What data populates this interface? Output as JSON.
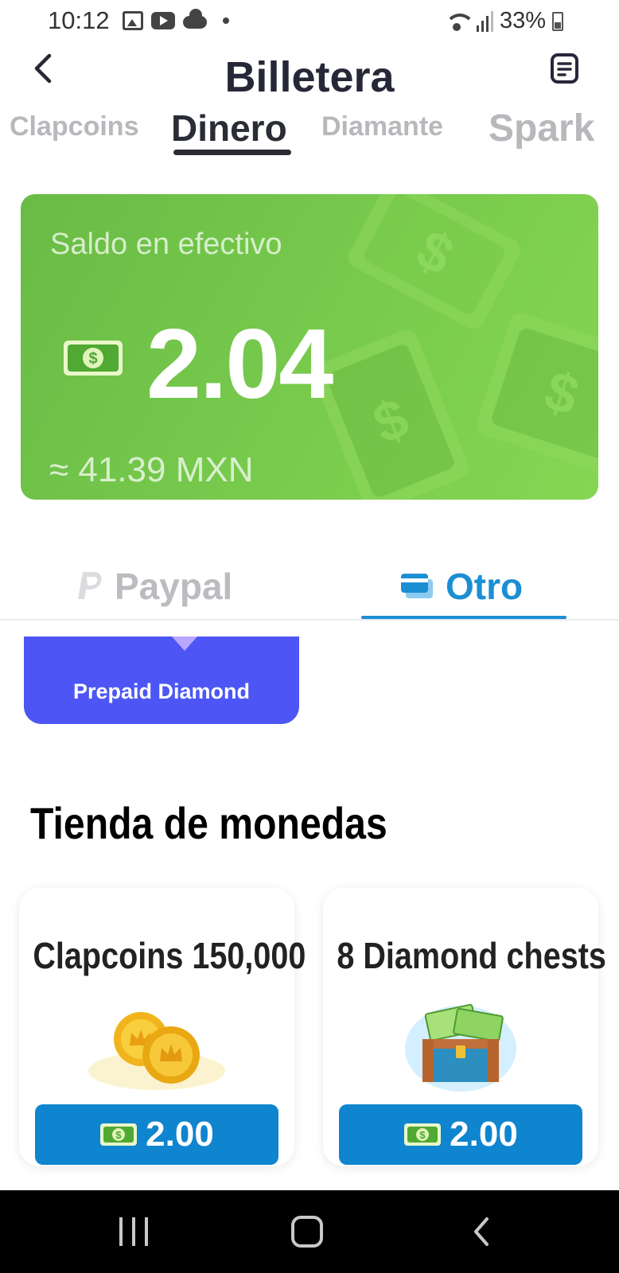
{
  "status_bar": {
    "time": "10:12",
    "battery": "33%",
    "icons": [
      "gallery-icon",
      "youtube-icon",
      "cloud-icon",
      "dot-icon",
      "wifi-icon",
      "signal-icon",
      "battery-icon"
    ]
  },
  "header": {
    "title": "Billetera",
    "back_icon": "chevron-left-icon",
    "records_icon": "document-icon"
  },
  "currency_tabs": {
    "items": [
      {
        "label": "Clapcoins",
        "active": false
      },
      {
        "label": "Dinero",
        "active": true
      },
      {
        "label": "Diamante",
        "active": false
      },
      {
        "label": "Spark",
        "active": false
      }
    ]
  },
  "balance": {
    "label": "Saldo en efectivo",
    "amount": "2.04",
    "approx": "≈ 41.39 MXN",
    "icon": "cash-icon",
    "card_color": "#72c34a"
  },
  "payment_methods": {
    "items": [
      {
        "label": "Paypal",
        "icon": "paypal-icon",
        "active": false
      },
      {
        "label": "Otro",
        "icon": "cards-icon",
        "active": true
      }
    ],
    "active_color": "#1c8ed4"
  },
  "prepaid": {
    "label": "Prepaid Diamond",
    "color": "#4d56f5"
  },
  "shop": {
    "title": "Tienda de monedas",
    "products": [
      {
        "name": "Clapcoins 150,000",
        "image": "gold-coins-icon",
        "price": "2.00"
      },
      {
        "name": "8 Diamond chests",
        "image": "treasure-chest-icon",
        "price": "2.00"
      }
    ],
    "button_color": "#0f85cf"
  },
  "nav_bar": {
    "items": [
      "recents-icon",
      "home-icon",
      "back-icon"
    ]
  }
}
